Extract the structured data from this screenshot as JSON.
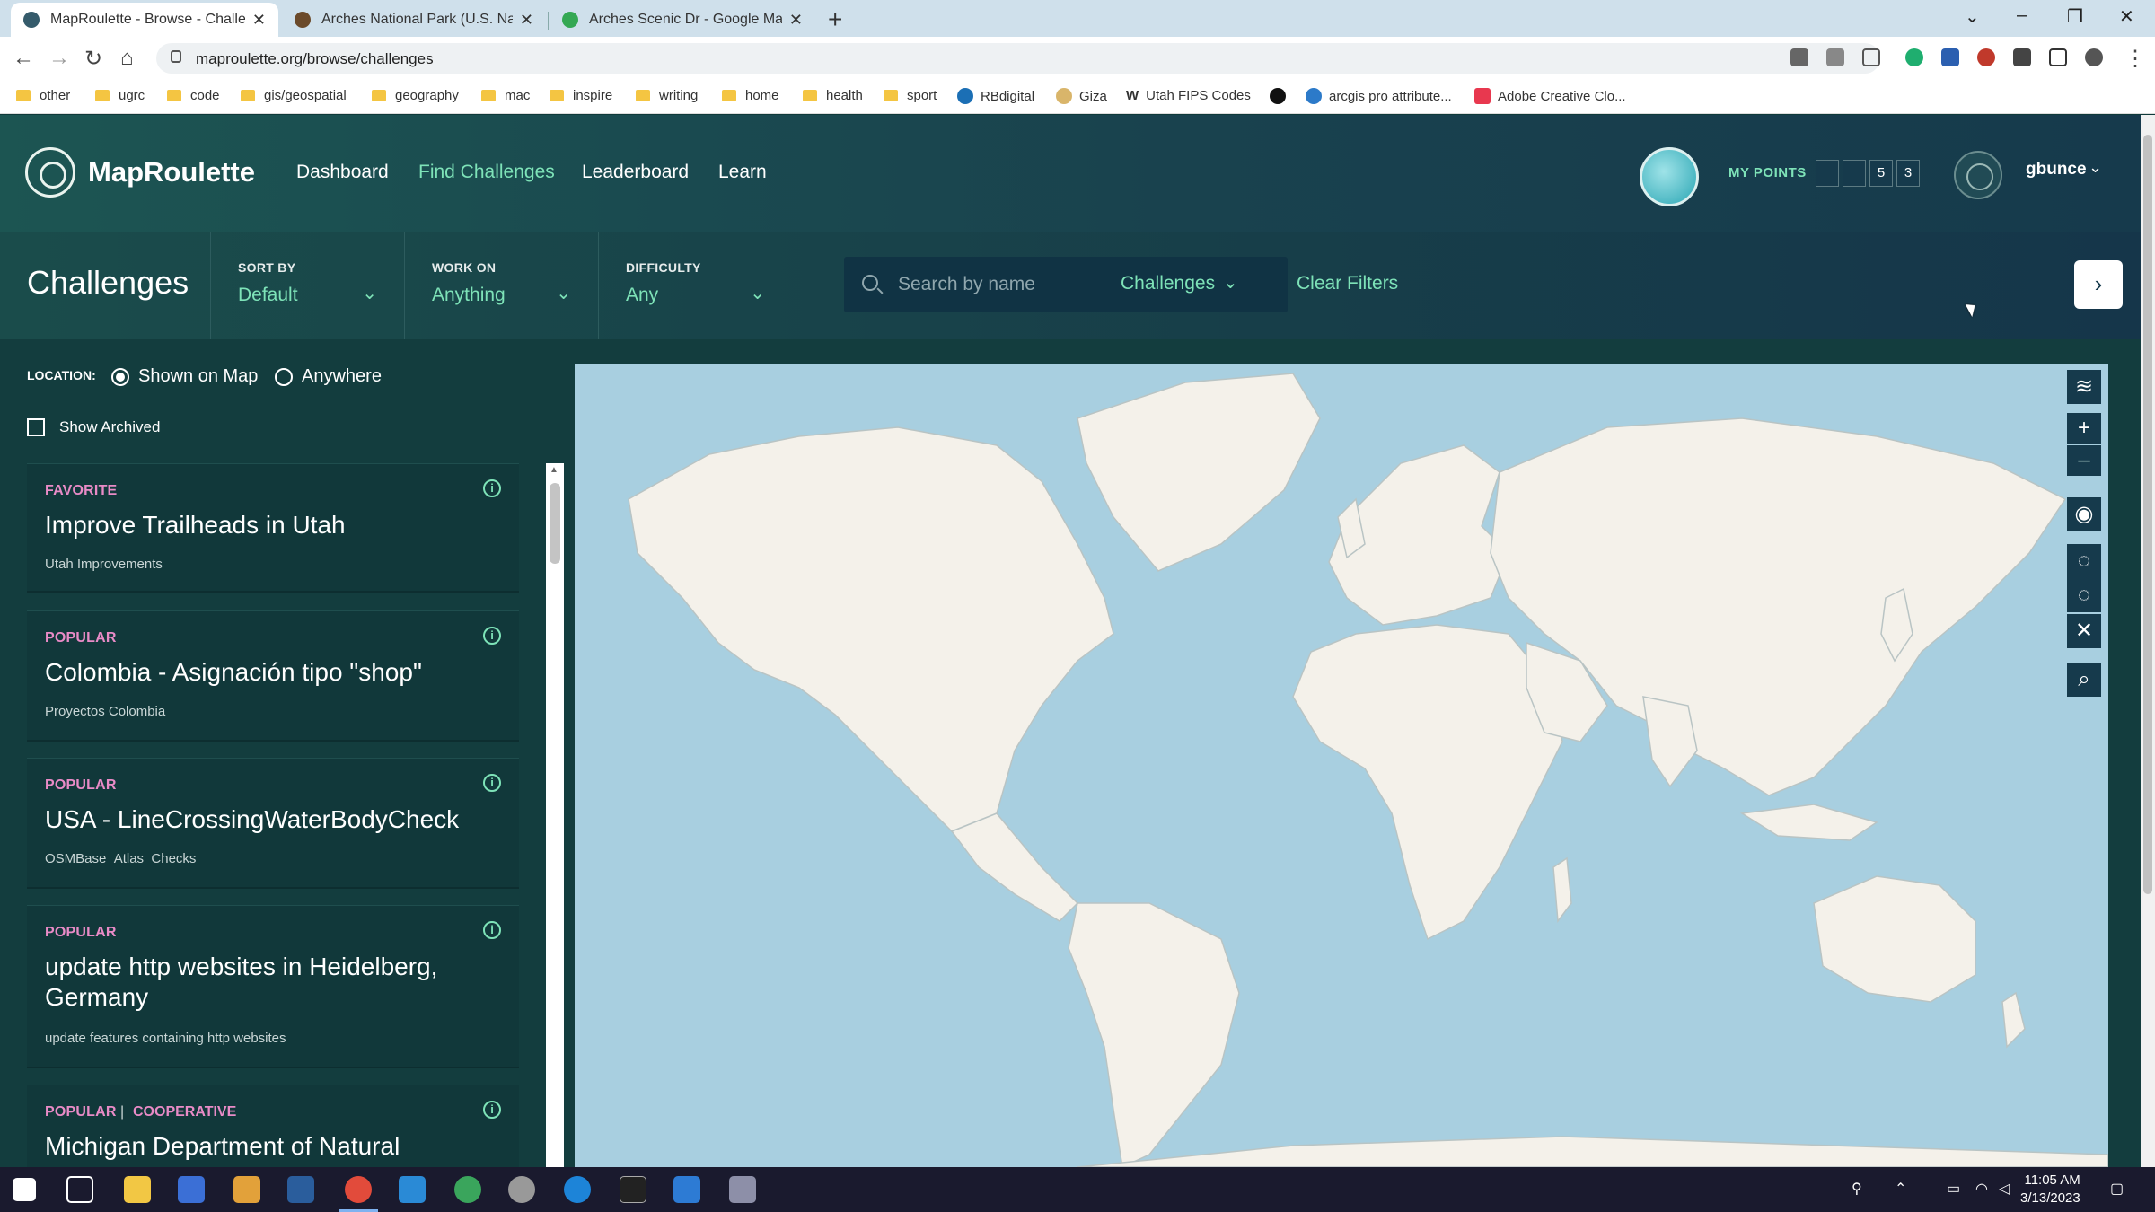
{
  "browser": {
    "tabs": [
      {
        "title": "MapRoulette - Browse - Challenges",
        "active": true
      },
      {
        "title": "Arches National Park (U.S. National Park Service)",
        "active": false
      },
      {
        "title": "Arches Scenic Dr - Google Maps",
        "active": false
      }
    ],
    "url": "maproulette.org/browse/challenges",
    "bookmarks": [
      "other",
      "ugrc",
      "code",
      "gis/geospatial",
      "geography",
      "mac",
      "inspire",
      "writing",
      "home",
      "health",
      "sport",
      "RBdigital",
      "Giza",
      "Utah FIPS Codes",
      "",
      "arcgis pro attribute...",
      "Adobe Creative Clo..."
    ]
  },
  "header": {
    "logo_text": "MapRoulette",
    "nav": [
      "Dashboard",
      "Find Challenges",
      "Leaderboard",
      "Learn"
    ],
    "active_nav": "Find Challenges",
    "my_points_label": "MY POINTS",
    "points_digits": [
      "",
      "",
      "5",
      "3"
    ],
    "username": "gbunce"
  },
  "filters": {
    "page_title": "Challenges",
    "sort_by": {
      "label": "SORT BY",
      "value": "Default"
    },
    "work_on": {
      "label": "WORK ON",
      "value": "Anything"
    },
    "difficulty": {
      "label": "DIFFICULTY",
      "value": "Any"
    },
    "search_placeholder": "Search by name",
    "search_type": "Challenges",
    "clear_filters": "Clear Filters"
  },
  "location": {
    "label": "LOCATION:",
    "options": [
      "Shown on Map",
      "Anywhere"
    ],
    "selected": "Shown on Map",
    "show_archived": "Show Archived"
  },
  "challenges": [
    {
      "badges": [
        "FAVORITE"
      ],
      "title": "Improve Trailheads in Utah",
      "subtitle": "Utah Improvements"
    },
    {
      "badges": [
        "POPULAR"
      ],
      "title": "Colombia - Asignación tipo \"shop\"",
      "subtitle": "Proyectos Colombia"
    },
    {
      "badges": [
        "POPULAR"
      ],
      "title": "USA - LineCrossingWaterBodyCheck",
      "subtitle": "OSMBase_Atlas_Checks"
    },
    {
      "badges": [
        "POPULAR"
      ],
      "title": "update http websites in Heidelberg, Germany",
      "subtitle": "update features containing http websites"
    },
    {
      "badges": [
        "POPULAR",
        "COOPERATIVE"
      ],
      "title": "Michigan Department of Natural",
      "subtitle": ""
    }
  ],
  "badge_separator": "|",
  "map_controls": [
    "layers-icon",
    "zoom-in-icon",
    "zoom-out-icon",
    "globe-icon",
    "lasso-icon",
    "lasso-deselect-icon",
    "clear-icon",
    "search-icon"
  ],
  "taskbar": {
    "time": "11:05 AM",
    "date": "3/13/2023"
  },
  "colors": {
    "accent": "#7ee3b8",
    "badge": "#e98bc7",
    "header_bg": "#1c5552",
    "map_water": "#a8cfe0",
    "map_land": "#f4f1ea"
  }
}
